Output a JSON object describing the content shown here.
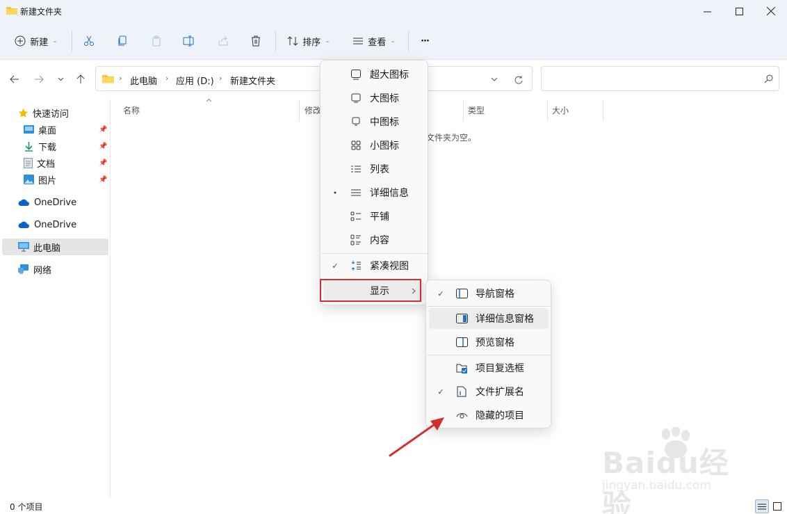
{
  "window": {
    "title": "新建文件夹"
  },
  "toolbar": {
    "new_label": "新建",
    "sort_label": "排序",
    "view_label": "查看",
    "more_label": "···"
  },
  "address": {
    "crumbs": [
      "此电脑",
      "应用 (D:)",
      "新建文件夹"
    ],
    "search_placeholder": ""
  },
  "sidebar": {
    "items": [
      {
        "label": "快速访问",
        "icon": "star-icon"
      },
      {
        "label": "桌面",
        "icon": "desktop-icon",
        "pinned": true
      },
      {
        "label": "下载",
        "icon": "download-icon",
        "pinned": true
      },
      {
        "label": "文档",
        "icon": "document-icon",
        "pinned": true
      },
      {
        "label": "图片",
        "icon": "picture-icon",
        "pinned": true
      },
      {
        "label": "OneDrive",
        "icon": "cloud-icon"
      },
      {
        "label": "OneDrive",
        "icon": "cloud-icon"
      },
      {
        "label": "此电脑",
        "icon": "computer-icon",
        "selected": true
      },
      {
        "label": "网络",
        "icon": "network-icon"
      }
    ]
  },
  "columns": [
    "名称",
    "修改",
    "类型",
    "大小"
  ],
  "empty_text": "文件夹为空。",
  "status": {
    "count": "0 个项目"
  },
  "view_menu": {
    "items": [
      {
        "label": "超大图标",
        "icon": "extra-large-icons-icon"
      },
      {
        "label": "大图标",
        "icon": "large-icons-icon"
      },
      {
        "label": "中图标",
        "icon": "medium-icons-icon"
      },
      {
        "label": "小图标",
        "icon": "small-icons-icon"
      },
      {
        "label": "列表",
        "icon": "list-icon"
      },
      {
        "label": "详细信息",
        "icon": "details-icon",
        "selected": true
      },
      {
        "label": "平铺",
        "icon": "tiles-icon"
      },
      {
        "label": "内容",
        "icon": "content-icon"
      },
      {
        "label": "紧凑视图",
        "icon": "compact-view-icon",
        "checked": true
      },
      {
        "label": "显示",
        "submenu": true
      }
    ]
  },
  "show_menu": {
    "items": [
      {
        "label": "导航窗格",
        "icon": "navigation-pane-icon",
        "checked": true
      },
      {
        "label": "详细信息窗格",
        "icon": "details-pane-icon"
      },
      {
        "label": "预览窗格",
        "icon": "preview-pane-icon"
      },
      {
        "label": "项目复选框",
        "icon": "item-checkbox-icon"
      },
      {
        "label": "文件扩展名",
        "icon": "file-extension-icon",
        "checked": true
      },
      {
        "label": "隐藏的项目",
        "icon": "hidden-items-icon"
      }
    ]
  },
  "watermark": {
    "word": "Baidu经验",
    "url": "jingyan.baidu.com"
  },
  "colors": {
    "accent": "#0067c0",
    "highlight_box": "#d42f2f",
    "folder": "#f4c542"
  }
}
